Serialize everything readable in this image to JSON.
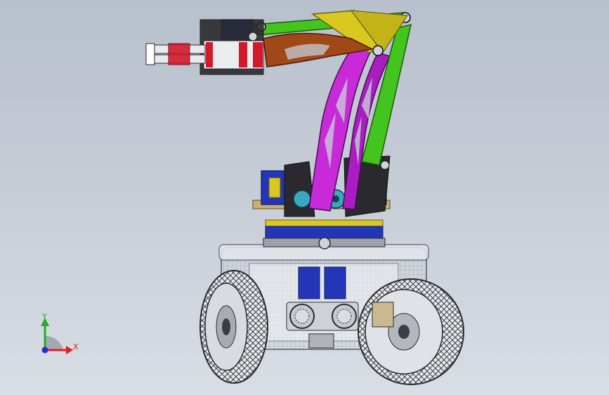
{
  "viewport": {
    "model_type": "robot-arm-on-wheeled-base-assembly",
    "display_mode": "shaded-with-hidden-edges-visible"
  },
  "triad": {
    "x_label": "X",
    "y_label": "Y",
    "colors": {
      "x": "#e02020",
      "y": "#20b020",
      "z": "#2030d0"
    }
  },
  "parts": {
    "colors": {
      "upper_link_green": "#44c41e",
      "lower_link_magenta": "#c82ad8",
      "forearm_brown": "#a04818",
      "pivot_yellow": "#d8c820",
      "servo_blue": "#2436b8",
      "gripper_red": "#d21a2a",
      "bracket_dark": "#2a2a2e",
      "chassis_gray": "#8a9098",
      "wheel_dark": "#3a3d42"
    }
  }
}
